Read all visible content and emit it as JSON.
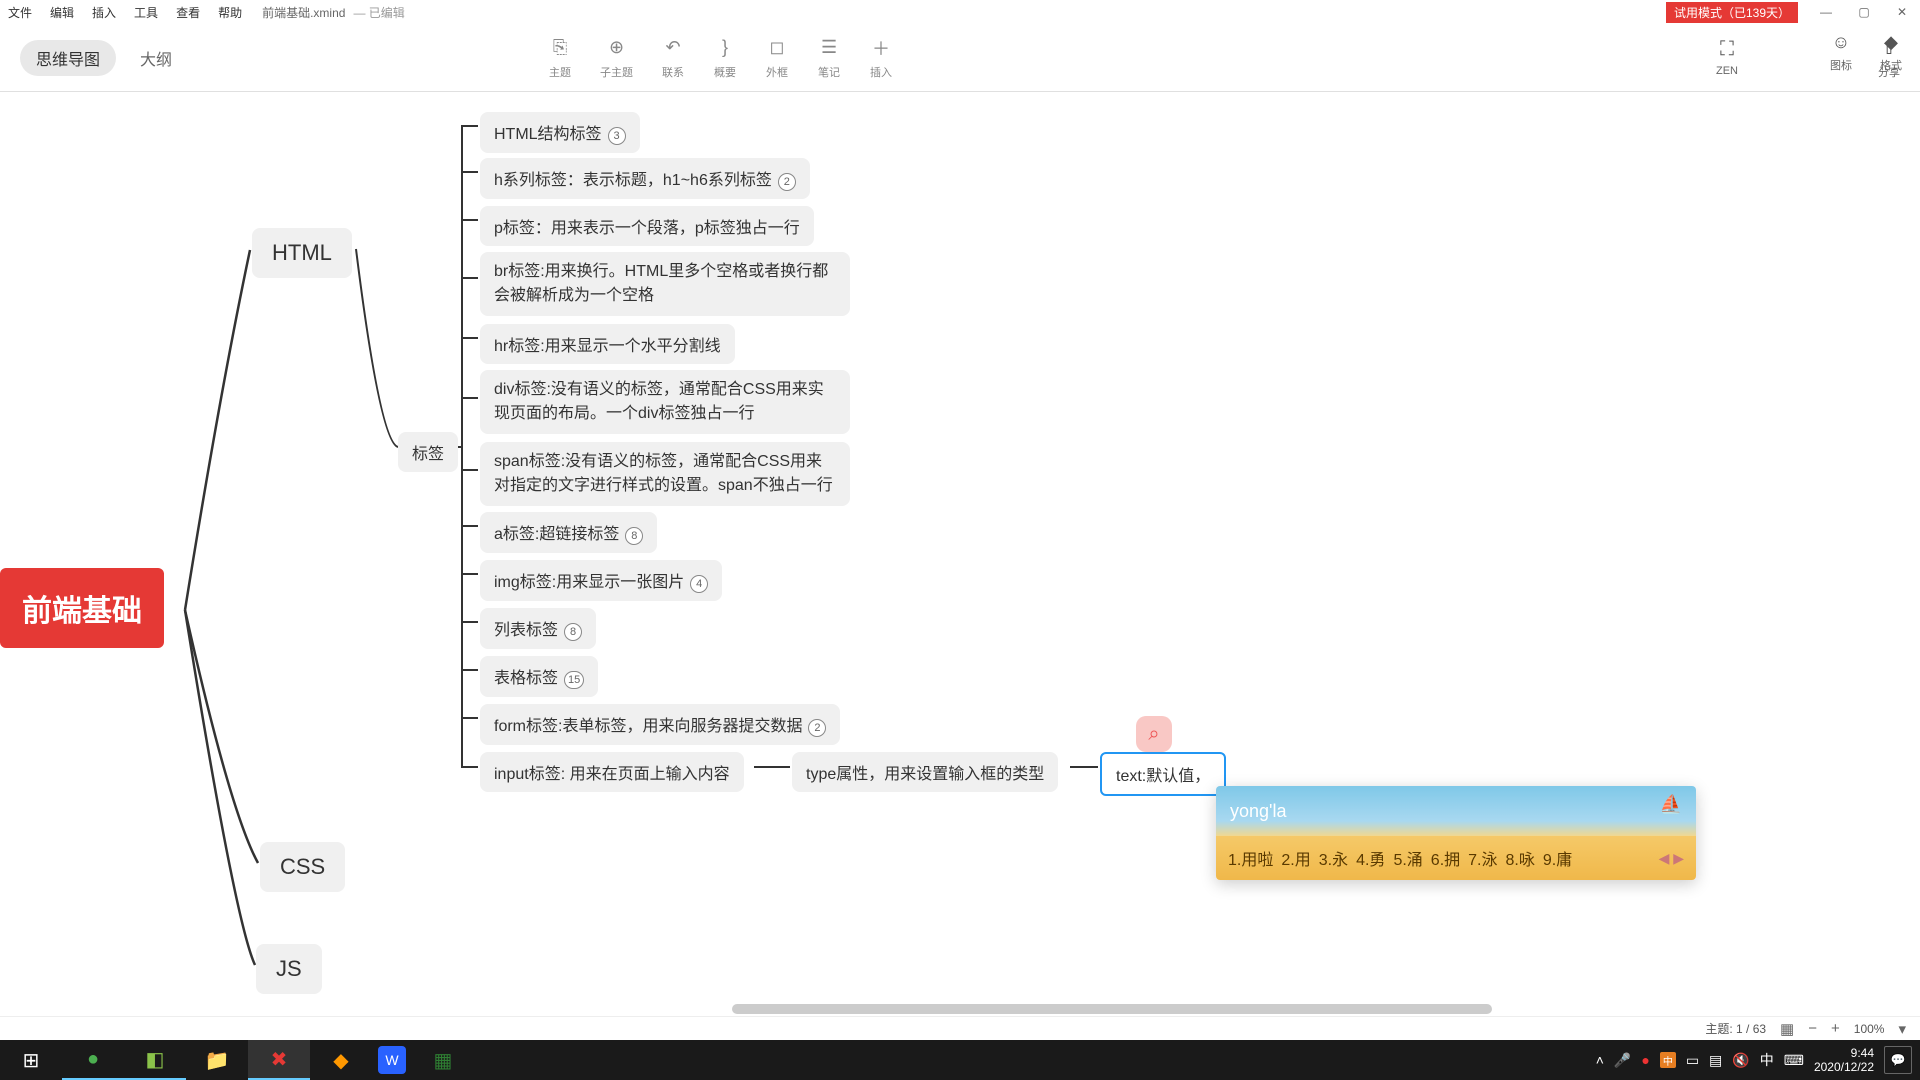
{
  "menubar": [
    "文件",
    "编辑",
    "插入",
    "工具",
    "查看",
    "帮助"
  ],
  "doc_name": "前端基础.xmind",
  "doc_status": "— 已编辑",
  "trial": "试用模式（已139天）",
  "view_tabs": {
    "mindmap": "思维导图",
    "outline": "大纲"
  },
  "toolbar": [
    {
      "icon": "⎘",
      "label": "主题"
    },
    {
      "icon": "⊕",
      "label": "子主题"
    },
    {
      "icon": "↶",
      "label": "联系"
    },
    {
      "icon": "}",
      "label": "概要"
    },
    {
      "icon": "◻",
      "label": "外框"
    },
    {
      "icon": "☰",
      "label": "笔记"
    },
    {
      "icon": "＋",
      "label": "插入"
    }
  ],
  "right_tools": {
    "zen": {
      "icon": "⛶",
      "label": "ZEN"
    },
    "share": {
      "icon": "⇧",
      "label": "分享"
    }
  },
  "side_tools": {
    "icons": {
      "icon": "☺",
      "label": "图标"
    },
    "format": {
      "icon": "◆",
      "label": "格式"
    }
  },
  "mindmap": {
    "root": "前端基础",
    "branches": {
      "html": "HTML",
      "css": "CSS",
      "js": "JS",
      "tags": "标签"
    },
    "nodes": {
      "n1": {
        "text": "HTML结构标签",
        "count": "3"
      },
      "n2": {
        "text": "h系列标签：表示标题，h1~h6系列标签",
        "count": "2"
      },
      "n3": {
        "text": "p标签：用来表示一个段落，p标签独占一行"
      },
      "n4": {
        "text": "br标签:用来换行。HTML里多个空格或者换行都会被解析成为一个空格"
      },
      "n5": {
        "text": "hr标签:用来显示一个水平分割线"
      },
      "n6": {
        "text": "div标签:没有语义的标签，通常配合CSS用来实现页面的布局。一个div标签独占一行"
      },
      "n7": {
        "text": "span标签:没有语义的标签，通常配合CSS用来对指定的文字进行样式的设置。span不独占一行"
      },
      "n8": {
        "text": "a标签:超链接标签",
        "count": "8"
      },
      "n9": {
        "text": "img标签:用来显示一张图片",
        "count": "4"
      },
      "n10": {
        "text": "列表标签",
        "count": "8"
      },
      "n11": {
        "text": "表格标签",
        "count": "15"
      },
      "n12": {
        "text": "form标签:表单标签，用来向服务器提交数据",
        "count": "2"
      },
      "n13": {
        "text": "input标签: 用来在页面上输入内容"
      },
      "n14": {
        "text": "type属性，用来设置输入框的类型"
      },
      "n15": {
        "text": "text:默认值，"
      }
    }
  },
  "ime": {
    "input": "yong'la",
    "candidates": [
      "1.用啦",
      "2.用",
      "3.永",
      "4.勇",
      "5.涌",
      "6.拥",
      "7.泳",
      "8.咏",
      "9.庸"
    ]
  },
  "statusbar": {
    "topic": "主题: 1 / 63",
    "zoom": "100%"
  },
  "clock": {
    "time": "9:44",
    "date": "2020/12/22"
  }
}
